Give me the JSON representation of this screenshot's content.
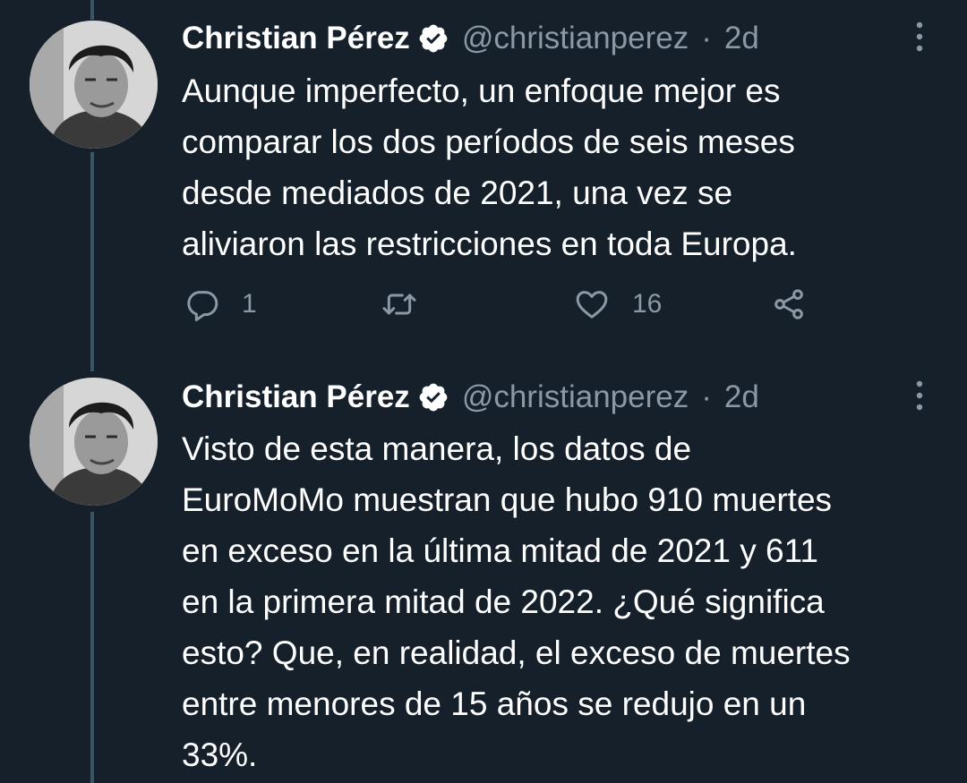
{
  "tweets": [
    {
      "display_name": "Christian Pérez",
      "handle": "@christianperez",
      "separator": "·",
      "time": "2d",
      "text": "Aunque imperfecto, un enfoque mejor es\ncomparar los dos períodos de seis meses\ndesde mediados de 2021, una vez se\naliviaron las restricciones en toda Europa.",
      "actions": {
        "reply_count": "1",
        "retweet_count": "",
        "like_count": "16"
      }
    },
    {
      "display_name": "Christian Pérez",
      "handle": "@christianperez",
      "separator": "·",
      "time": "2d",
      "text": "Visto de esta manera, los datos de\nEuroMoMo muestran que hubo 910 muertes\nen exceso en la última mitad de 2021 y 611\nen la primera mitad de 2022. ¿Qué significa\nesto? Que, en realidad, el exceso de muertes\nentre menores de 15 años se redujo en un\n33%."
    }
  ],
  "colors": {
    "background": "#15202b",
    "text_primary": "#ffffff",
    "text_secondary": "#8b98a5",
    "thread_line": "#3d5466",
    "verified_badge": "#ffffff"
  },
  "icons": {
    "verified": "verified-badge-icon",
    "more": "more-options-icon",
    "reply": "reply-icon",
    "retweet": "retweet-icon",
    "like": "heart-icon",
    "share": "share-icon"
  }
}
